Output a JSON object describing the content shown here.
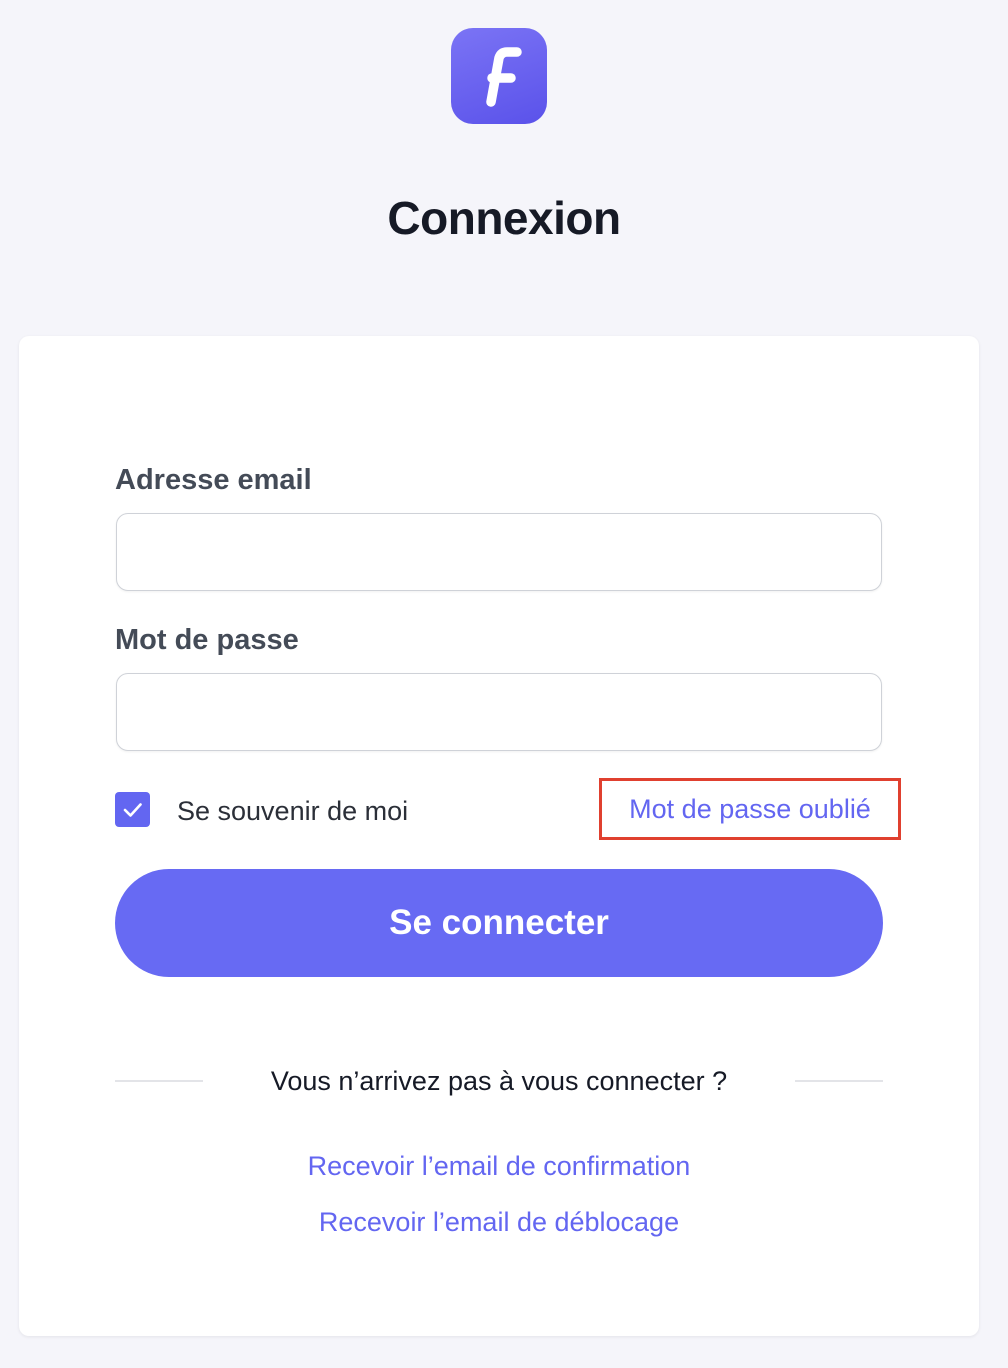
{
  "brand": {
    "logo_letter": "F",
    "accent_color": "#6366f1"
  },
  "page": {
    "title": "Connexion"
  },
  "form": {
    "email_label": "Adresse email",
    "email_value": "",
    "password_label": "Mot de passe",
    "password_value": "",
    "remember_label": "Se souvenir de moi",
    "remember_checked": true,
    "forgot_link": "Mot de passe oublié",
    "submit_label": "Se connecter"
  },
  "help": {
    "divider_text": "Vous n’arrivez pas à vous connecter ?",
    "links": [
      "Recevoir l’email de confirmation",
      "Recevoir l’email de déblocage"
    ]
  },
  "icons": {
    "logo": "app-logo-icon",
    "checkbox_mark": "checkmark-icon"
  }
}
